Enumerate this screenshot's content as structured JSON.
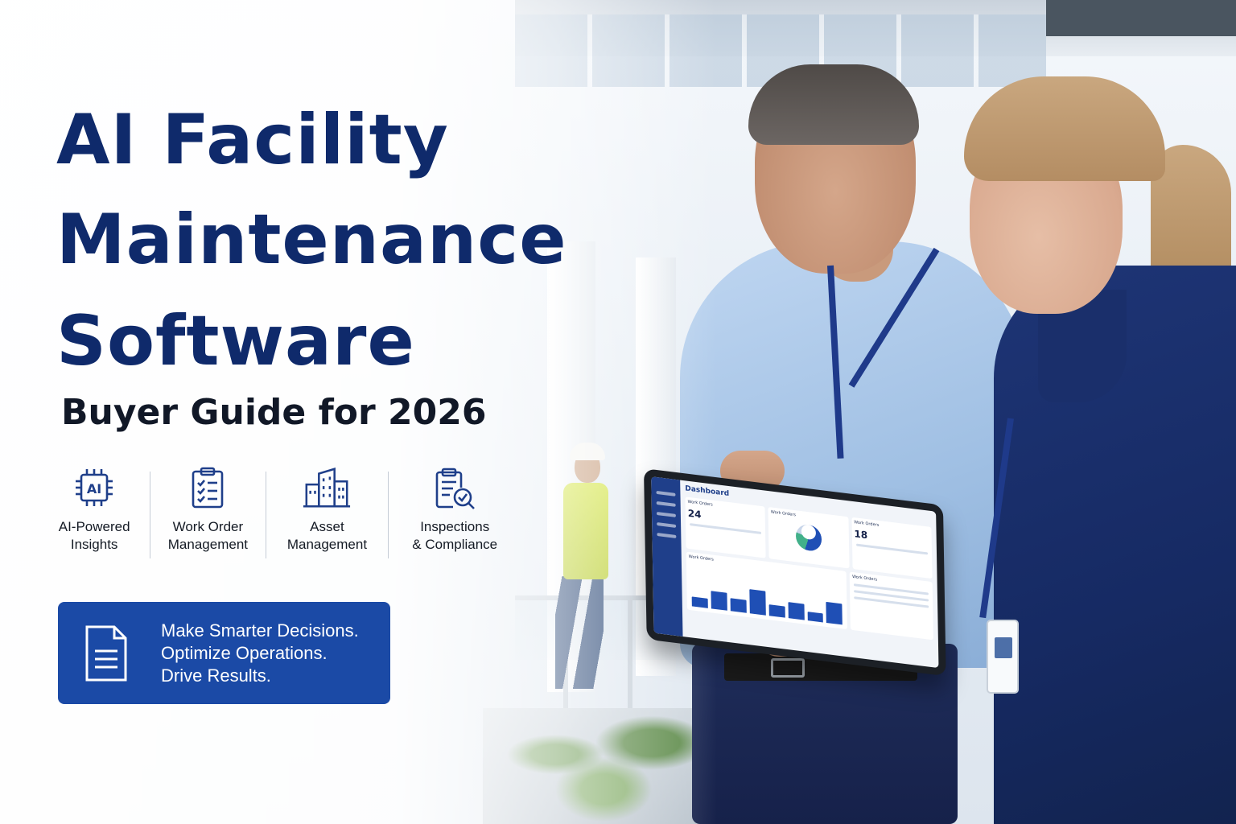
{
  "headline": {
    "line1": "AI Facility",
    "line2": "Maintenance",
    "line3": "Software",
    "subtitle": "Buyer Guide for 2026"
  },
  "colors": {
    "headline": "#0f2a6b",
    "accent": "#1b4aa6",
    "icon_stroke": "#1f3f8a"
  },
  "features": [
    {
      "icon": "ai-chip-icon",
      "icon_text": "AI",
      "line1": "AI-Powered",
      "line2": "Insights"
    },
    {
      "icon": "clipboard-checklist-icon",
      "line1": "Work Order",
      "line2": "Management"
    },
    {
      "icon": "buildings-icon",
      "line1": "Asset",
      "line2": "Management"
    },
    {
      "icon": "clipboard-search-icon",
      "line1": "Inspections",
      "line2": "& Compliance"
    }
  ],
  "cta": {
    "icon": "document-icon",
    "line1": "Make Smarter Decisions.",
    "line2": "Optimize Operations.",
    "line3": "Drive Results."
  },
  "tablet": {
    "title": "Dashboard",
    "card1_label": "Work Orders",
    "card1_value": "24",
    "card2_label": "Work Orders",
    "card3_label": "Work Orders",
    "card3_value": "18",
    "panel1_label": "Work Orders",
    "panel2_label": "Work Orders"
  }
}
